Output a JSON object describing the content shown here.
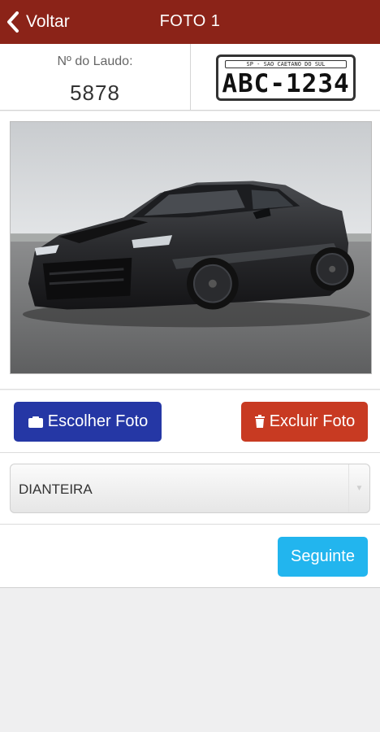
{
  "header": {
    "back_label": "Voltar",
    "title": "FOTO 1",
    "bar_color": "#8b2318"
  },
  "laudo": {
    "label": "Nº do Laudo:",
    "number": "5878"
  },
  "plate": {
    "region": "SP - SAO CAETANO DO SUL",
    "number": "ABC-1234"
  },
  "photo": {
    "subject": "dark grey sports car"
  },
  "actions": {
    "choose_label": "Escolher Foto",
    "choose_icon": "camera-icon",
    "choose_color": "#2537a5",
    "delete_label": "Excluir Foto",
    "delete_icon": "trash-icon",
    "delete_color": "#c83a22"
  },
  "position_select": {
    "selected": "DIANTEIRA"
  },
  "footer": {
    "next_label": "Seguinte",
    "next_color": "#22b5ee"
  }
}
